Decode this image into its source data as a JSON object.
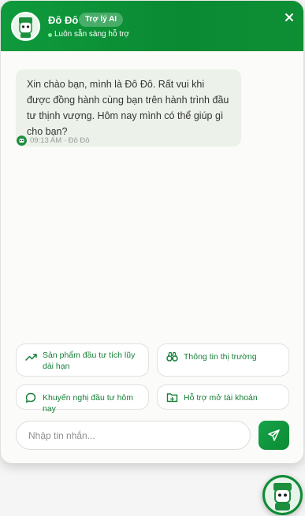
{
  "header": {
    "name": "Đô Đô",
    "badge": "Trợ lý AI",
    "status": "Luôn sẵn sàng hỗ trợ",
    "close_icon": "close-icon"
  },
  "message": {
    "text": "Xin chào bạn, mình là Đô Đô. Rất vui khi được đồng hành cùng bạn trên hành trình đầu tư thịnh vượng. Hôm nay mình có thể giúp gì cho bạn?",
    "time": "09:13 AM · Đô Đô"
  },
  "suggestions": [
    {
      "label": "Sản phẩm đầu tư tích lũy dài hạn",
      "icon": "trending-up-icon"
    },
    {
      "label": "Thông tin thị trường",
      "icon": "binoculars-icon"
    },
    {
      "label": "Khuyến nghị đầu tư hôm nay",
      "icon": "chat-bubble-icon"
    },
    {
      "label": "Hỗ trợ mở tài khoản",
      "icon": "folder-icon"
    }
  ],
  "input": {
    "placeholder": "Nhập tin nhắn..."
  },
  "colors": {
    "brand": "#0f9a3c",
    "accent_text": "#167f36",
    "bubble": "#ecf2ea"
  }
}
